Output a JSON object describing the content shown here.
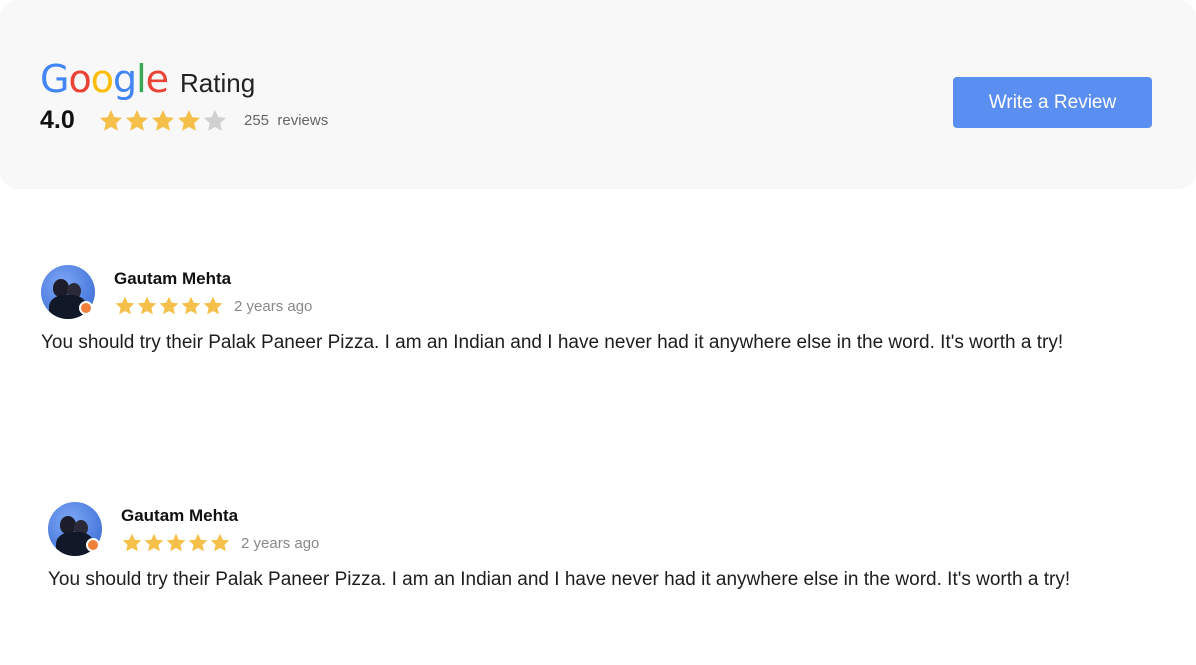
{
  "header": {
    "logo_letters": [
      {
        "char": "G",
        "color": "#4285F4"
      },
      {
        "char": "o",
        "color": "#EA4335"
      },
      {
        "char": "o",
        "color": "#FBBC05"
      },
      {
        "char": "g",
        "color": "#4285F4"
      },
      {
        "char": "l",
        "color": "#34A853"
      },
      {
        "char": "e",
        "color": "#EA4335"
      }
    ],
    "rating_label": "Rating",
    "score": "4.0",
    "star_rating": 4,
    "star_max": 5,
    "review_count": "255",
    "review_count_suffix": "reviews",
    "write_review_label": "Write a Review"
  },
  "colors": {
    "star_filled": "#F4C04A",
    "star_empty": "#D0D0D0",
    "button_bg": "#5A8EF0",
    "badge": "#F0803A"
  },
  "reviews": [
    {
      "name": "Gautam Mehta",
      "rating": 5,
      "time": "2 years ago",
      "text": "You should try their Palak Paneer Pizza. I am an Indian and I have never had it anywhere else in the word. It's worth a try!"
    },
    {
      "name": "Gautam Mehta",
      "rating": 5,
      "time": "2 years ago",
      "text": "You should try their Palak Paneer Pizza. I am an Indian and I have never had it anywhere else in the word. It's worth a try!"
    }
  ]
}
